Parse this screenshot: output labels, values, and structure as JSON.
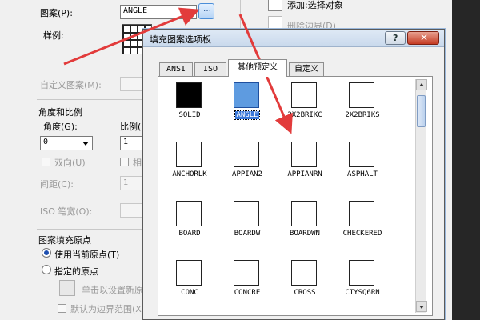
{
  "hatch_dialog": {
    "pattern_label": "图案(P):",
    "pattern_value": "ANGLE",
    "swatch_label": "样例:",
    "custom_pattern_label": "自定义图案(M):",
    "angle_scale_header": "角度和比例",
    "angle_label": "角度(G):",
    "angle_value": "0",
    "scale_label": "比例(",
    "scale_value": "1",
    "double_label": "双向(U)",
    "relative_label": "相",
    "spacing_label": "间距(C):",
    "spacing_value": "1",
    "iso_pen_label": "ISO 笔宽(O):",
    "origin_header": "图案填充原点",
    "use_current_origin": "使用当前原点(T)",
    "specified_origin": "指定的原点",
    "click_set_origin": "单击以设置新原",
    "default_boundary": "默认为边界范围(X"
  },
  "right_panel": {
    "add_select": "添加:选择对象",
    "remove_boundary": "删除边界(D)"
  },
  "palette": {
    "title": "填充图案选项板",
    "help_glyph": "?",
    "close_glyph": "✕",
    "tabs": [
      {
        "label": "ANSI"
      },
      {
        "label": "ISO"
      },
      {
        "label": "其他预定义"
      },
      {
        "label": "自定义"
      }
    ],
    "patterns": [
      {
        "name": "SOLID",
        "pattern": "solid-icon"
      },
      {
        "name": "ANGLE",
        "pattern": "angle-icon",
        "selected": true
      },
      {
        "name": "2X2BRIKC",
        "pattern": "brick-icon"
      },
      {
        "name": "2X2BRIKS",
        "pattern": "brick-icon"
      },
      {
        "name": "ANCHORLK",
        "pattern": "anchorlock-icon"
      },
      {
        "name": "APPIAN2",
        "pattern": "brick-icon"
      },
      {
        "name": "APPIANRN",
        "pattern": "brick-icon"
      },
      {
        "name": "ASPHALT",
        "pattern": "asphalt-icon"
      },
      {
        "name": "BOARD",
        "pattern": "board-icon"
      },
      {
        "name": "BOARDW",
        "pattern": "board-icon"
      },
      {
        "name": "BOARDWN",
        "pattern": "board-icon"
      },
      {
        "name": "CHECKERED",
        "pattern": "checkered-icon"
      },
      {
        "name": "CONC",
        "pattern": "concrete-icon"
      },
      {
        "name": "CONCRE",
        "pattern": "concrete-icon"
      },
      {
        "name": "CROSS",
        "pattern": "cross-icon"
      },
      {
        "name": "CTYSQ6RN",
        "pattern": "brick-icon"
      }
    ]
  },
  "colors": {
    "annotation_arrow": "#e23b3b",
    "selection": "#3b78d8",
    "title_bar": "#c9d9ec",
    "close_button": "#c53b23"
  }
}
